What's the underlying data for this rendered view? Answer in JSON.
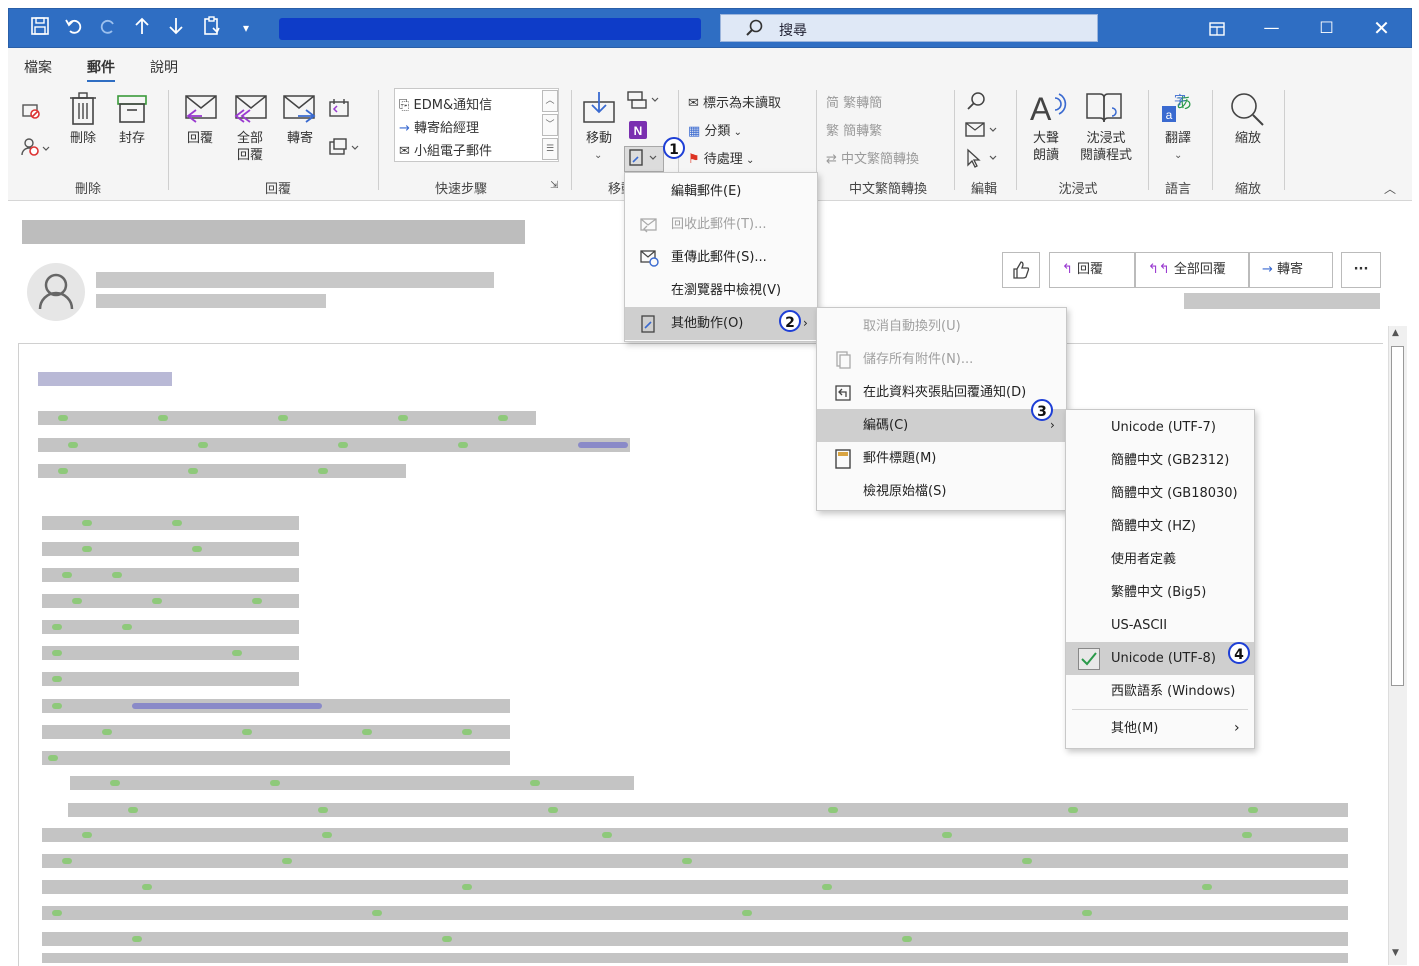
{
  "titlebar": {
    "search_label": "搜尋",
    "icons": [
      "save-icon",
      "undo-icon",
      "redo-icon",
      "up-icon",
      "down-icon",
      "clipboard-icon",
      "customize-icon"
    ]
  },
  "menubar": {
    "tabs": [
      "檔案",
      "郵件",
      "說明"
    ],
    "active": "郵件"
  },
  "ribbon": {
    "delete_group": {
      "label": "刪除",
      "delete": "刪除",
      "archive": "封存"
    },
    "reply_group": {
      "label": "回覆",
      "reply": "回覆",
      "reply_all_1": "全部",
      "reply_all_2": "回覆",
      "forward": "轉寄"
    },
    "quick_steps": {
      "label": "快速步驟",
      "items": [
        "EDM&通知信",
        "轉寄給經理",
        "小組電子郵件"
      ]
    },
    "move_group": {
      "label": "移動",
      "move": "移動"
    },
    "tags_group": {
      "mark_unread": "標示為未讀取",
      "categorize": "分類",
      "followup": "待處理"
    },
    "chinese_conv": {
      "label": "中文繁簡轉換",
      "t2s": "繁轉簡",
      "s2t": "簡轉繁",
      "conv": "中文繁簡轉換"
    },
    "edit_group": {
      "label": "編輯"
    },
    "immersive": {
      "label": "沈浸式",
      "read_aloud_1": "大聲",
      "read_aloud_2": "朗讀",
      "reader_1": "沈浸式",
      "reader_2": "閱讀程式"
    },
    "language": {
      "label": "語言",
      "translate": "翻譯"
    },
    "zoom": {
      "label": "縮放",
      "zoom": "縮放"
    }
  },
  "message_actions": {
    "reply": "回覆",
    "reply_all": "全部回覆",
    "forward": "轉寄",
    "more": "···"
  },
  "menu1": {
    "items": [
      {
        "label": "編輯郵件(E)",
        "disabled": false
      },
      {
        "label": "回收此郵件(T)...",
        "disabled": true
      },
      {
        "label": "重傳此郵件(S)...",
        "disabled": false
      },
      {
        "label": "在瀏覽器中檢視(V)",
        "disabled": false
      },
      {
        "label": "其他動作(O)",
        "disabled": false,
        "highlighted": true
      }
    ]
  },
  "menu2": {
    "items": [
      {
        "label": "取消自動換列(U)",
        "disabled": true
      },
      {
        "label": "儲存所有附件(N)...",
        "disabled": true
      },
      {
        "label": "在此資料夾張貼回覆通知(D)",
        "disabled": false
      },
      {
        "label": "編碼(C)",
        "disabled": false,
        "highlighted": true
      },
      {
        "label": "郵件標題(M)",
        "disabled": false
      },
      {
        "label": "檢視原始檔(S)",
        "disabled": false
      }
    ]
  },
  "menu3": {
    "items": [
      {
        "label": "Unicode (UTF-7)"
      },
      {
        "label": "簡體中文 (GB2312)"
      },
      {
        "label": "簡體中文 (GB18030)"
      },
      {
        "label": "簡體中文 (HZ)"
      },
      {
        "label": "使用者定義"
      },
      {
        "label": "繁體中文 (Big5)"
      },
      {
        "label": "US-ASCII"
      },
      {
        "label": "Unicode (UTF-8)",
        "checked": true
      },
      {
        "label": "西歐語系 (Windows)"
      },
      {
        "label": "其他(M)"
      }
    ]
  },
  "badges": [
    "1",
    "2",
    "3",
    "4"
  ],
  "colors": {
    "titlebar": "#2f6ec3",
    "badge_ring": "#1e3fd6",
    "highlight": "#cfcfcf"
  }
}
